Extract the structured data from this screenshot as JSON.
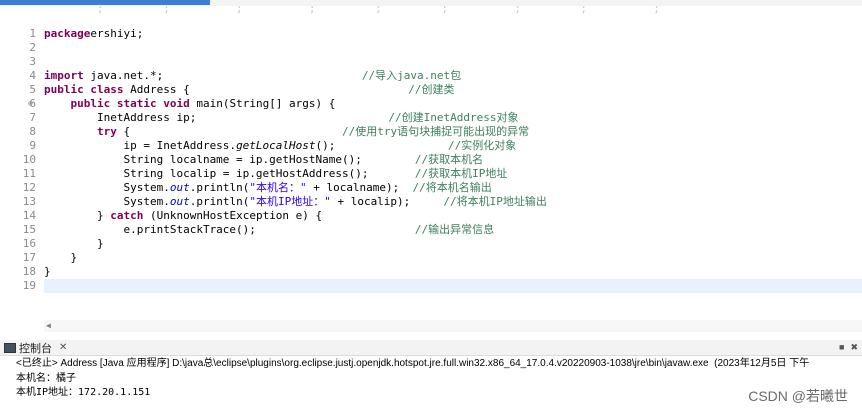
{
  "editor": {
    "cut_line": "        ;         ;          ;          ;         ;         ;          ;         ;          ;",
    "lines": [
      {
        "n": "1",
        "segments": [
          [
            "kw",
            "package"
          ],
          [
            "",
            "ershiyi;"
          ]
        ]
      },
      {
        "n": "2",
        "segments": []
      },
      {
        "n": "3",
        "segments": []
      },
      {
        "n": "4",
        "segments": [
          [
            "kw",
            "import"
          ],
          [
            "",
            " java.net.*;                              "
          ],
          [
            "cm",
            "//导入java.net包"
          ]
        ]
      },
      {
        "n": "5",
        "segments": [
          [
            "kw",
            "public class"
          ],
          [
            "",
            " Address {                                 "
          ],
          [
            "cm",
            "//创建类"
          ]
        ]
      },
      {
        "n": "6",
        "segments": [
          [
            "",
            "    "
          ],
          [
            "kw",
            "public static void"
          ],
          [
            "",
            " main(String[] args) {"
          ]
        ]
      },
      {
        "n": "7",
        "segments": [
          [
            "",
            "        InetAddress "
          ],
          [
            "",
            "ip;                             "
          ],
          [
            "cm",
            "//创建InetAddress对象"
          ]
        ]
      },
      {
        "n": "8",
        "segments": [
          [
            "",
            "        "
          ],
          [
            "kw",
            "try"
          ],
          [
            "",
            " {                                "
          ],
          [
            "cm",
            "//使用try语句块捕捉可能出现的异常"
          ]
        ]
      },
      {
        "n": "9",
        "segments": [
          [
            "",
            "            ip = InetAddress."
          ],
          [
            "it",
            "getLocalHost"
          ],
          [
            "",
            "();                 "
          ],
          [
            "cm",
            "//实例化对象"
          ]
        ]
      },
      {
        "n": "10",
        "segments": [
          [
            "",
            "            String localname = ip.getHostName();        "
          ],
          [
            "cm",
            "//获取本机名"
          ]
        ]
      },
      {
        "n": "11",
        "segments": [
          [
            "",
            "            String localip = ip.getHostAddress();       "
          ],
          [
            "cm",
            "//获取本机IP地址"
          ]
        ]
      },
      {
        "n": "12",
        "segments": [
          [
            "",
            "            System."
          ],
          [
            "fld it",
            "out"
          ],
          [
            "",
            ".println("
          ],
          [
            "st",
            "\"本机名：\""
          ],
          [
            "",
            " + localname);  "
          ],
          [
            "cm",
            "//将本机名输出"
          ]
        ]
      },
      {
        "n": "13",
        "segments": [
          [
            "",
            "            System."
          ],
          [
            "fld it",
            "out"
          ],
          [
            "",
            ".println("
          ],
          [
            "st",
            "\"本机IP地址：\""
          ],
          [
            "",
            " + localip);     "
          ],
          [
            "cm",
            "//将本机IP地址输出"
          ]
        ]
      },
      {
        "n": "14",
        "segments": [
          [
            "",
            "        } "
          ],
          [
            "kw",
            "catch"
          ],
          [
            "",
            " (UnknownHostException e) {"
          ]
        ]
      },
      {
        "n": "15",
        "segments": [
          [
            "",
            "            e.printStackTrace();                        "
          ],
          [
            "cm",
            "//输出异常信息"
          ]
        ]
      },
      {
        "n": "16",
        "segments": [
          [
            "",
            "        }"
          ]
        ]
      },
      {
        "n": "17",
        "segments": [
          [
            "",
            "    }"
          ]
        ]
      },
      {
        "n": "18",
        "segments": [
          [
            "",
            "}"
          ]
        ]
      },
      {
        "n": "19",
        "segments": []
      }
    ],
    "fold_marker": "⊖"
  },
  "console": {
    "tab_label": "控制台",
    "tab_close": "✕",
    "terminated_line": "<已终止> Address [Java 应用程序] D:\\java总\\eclipse\\plugins\\org.eclipse.justj.openjdk.hotspot.jre.full.win32.x86_64_17.0.4.v20220903-1038\\jre\\bin\\javaw.exe  (2023年12月5日 下午",
    "output": [
      "本机名：橘子",
      "本机IP地址：172.20.1.151"
    ]
  },
  "watermark": "CSDN @若曦世"
}
